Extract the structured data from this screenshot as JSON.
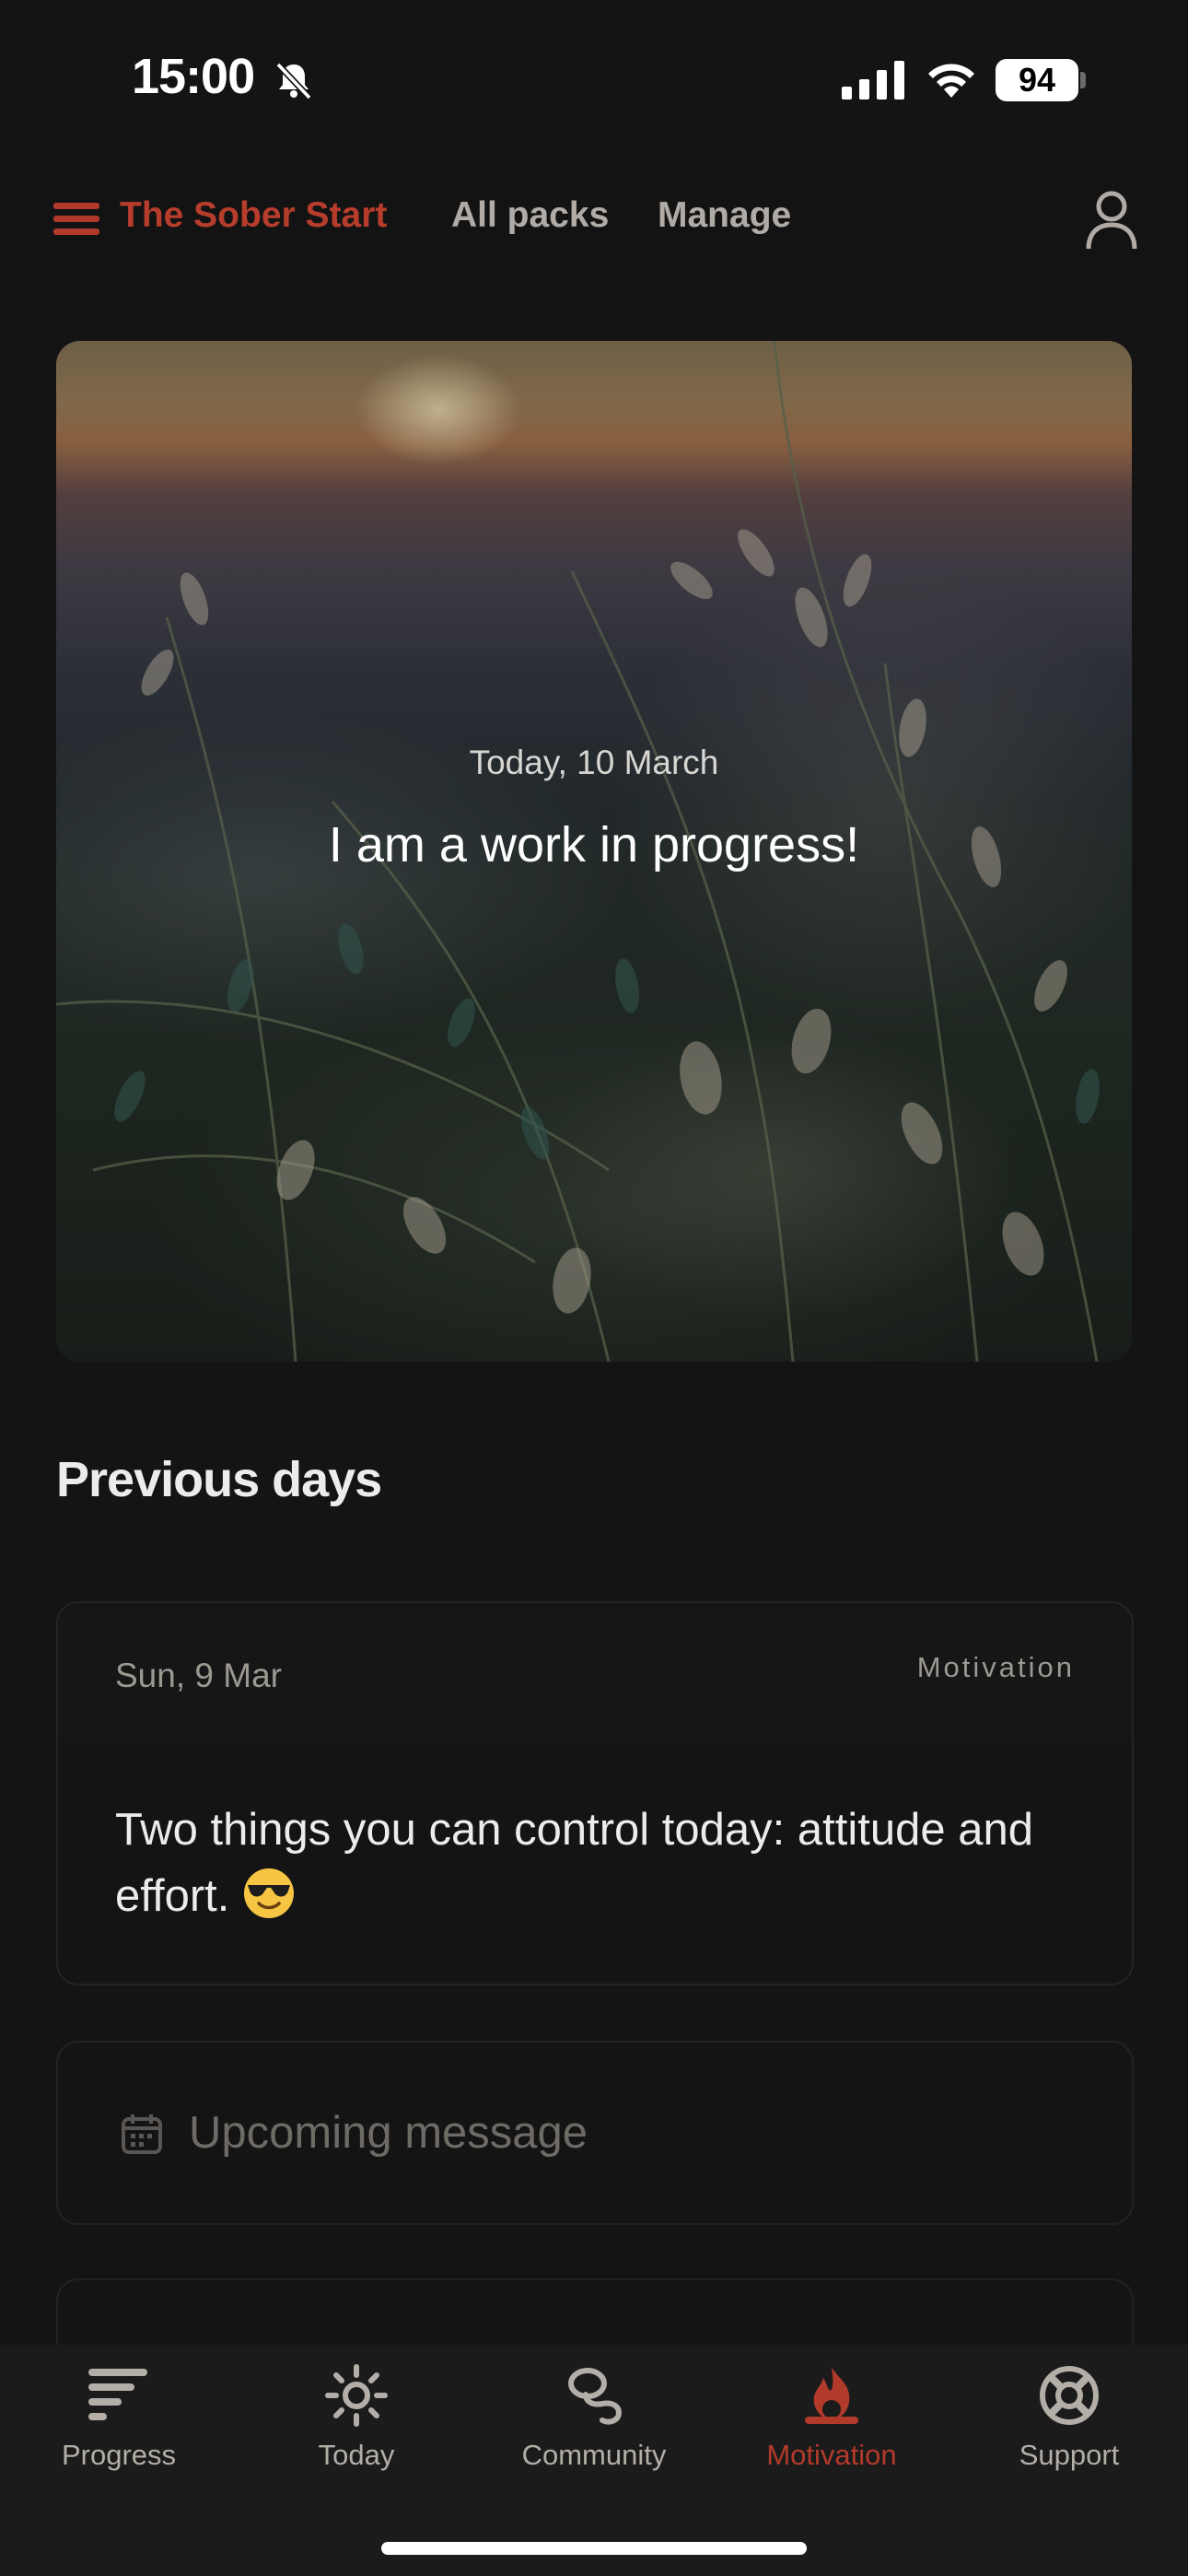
{
  "status_bar": {
    "time": "15:00",
    "battery": "94"
  },
  "nav": {
    "title": "The Sober Start",
    "links": [
      "All packs",
      "Manage"
    ]
  },
  "hero": {
    "date": "Today, 10 March",
    "quote": "I am a work in progress!"
  },
  "previous_days": {
    "title": "Previous days",
    "items": [
      {
        "date": "Sun, 9 Mar",
        "tag": "Motivation",
        "text": "Two things you can control today: attitude and effort."
      }
    ]
  },
  "upcoming": {
    "label": "Upcoming message"
  },
  "tabs": [
    {
      "label": "Progress",
      "icon": "progress-icon",
      "active": false
    },
    {
      "label": "Today",
      "icon": "sun-icon",
      "active": false
    },
    {
      "label": "Community",
      "icon": "community-icon",
      "active": false
    },
    {
      "label": "Motivation",
      "icon": "flame-icon",
      "active": true
    },
    {
      "label": "Support",
      "icon": "lifebuoy-icon",
      "active": false
    }
  ],
  "colors": {
    "accent": "#b23a2b",
    "background": "#141414",
    "tab_bar": "#1b1b1b"
  }
}
